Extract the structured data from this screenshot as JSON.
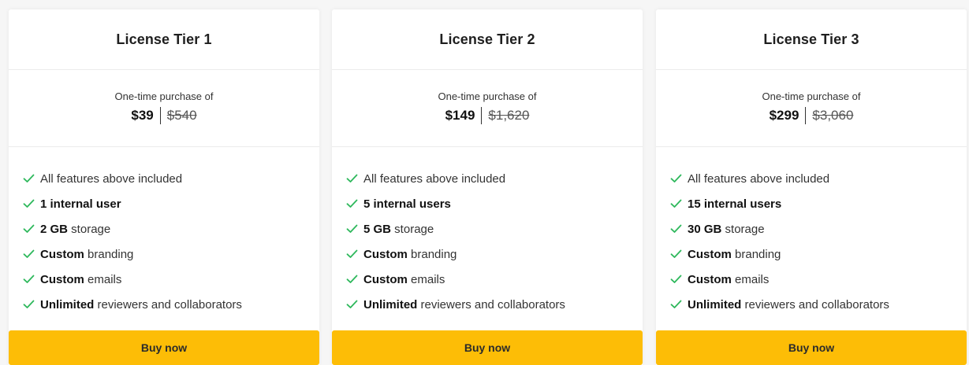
{
  "colors": {
    "accent_button": "#fdbd06",
    "check": "#2eb85c",
    "card_bg": "#ffffff",
    "page_bg": "#f6f6f6"
  },
  "tiers": [
    {
      "title": "License Tier 1",
      "price_caption": "One-time purchase of",
      "price": "$39",
      "old_price": "$540",
      "features": [
        {
          "icon": "check-icon",
          "bold": "",
          "text": "All features above included"
        },
        {
          "icon": "check-icon",
          "bold": "1 internal user",
          "text": ""
        },
        {
          "icon": "check-icon",
          "bold": "2 GB",
          "text": " storage"
        },
        {
          "icon": "check-icon",
          "bold": "Custom",
          "text": " branding"
        },
        {
          "icon": "check-icon",
          "bold": "Custom",
          "text": " emails"
        },
        {
          "icon": "check-icon",
          "bold": "Unlimited",
          "text": " reviewers and collaborators"
        }
      ],
      "button_label": "Buy now"
    },
    {
      "title": "License Tier 2",
      "price_caption": "One-time purchase of",
      "price": "$149",
      "old_price": "$1,620",
      "features": [
        {
          "icon": "check-icon",
          "bold": "",
          "text": "All features above included"
        },
        {
          "icon": "check-icon",
          "bold": "5 internal users",
          "text": ""
        },
        {
          "icon": "check-icon",
          "bold": "5 GB",
          "text": " storage"
        },
        {
          "icon": "check-icon",
          "bold": "Custom",
          "text": " branding"
        },
        {
          "icon": "check-icon",
          "bold": "Custom",
          "text": " emails"
        },
        {
          "icon": "check-icon",
          "bold": "Unlimited",
          "text": " reviewers and collaborators"
        }
      ],
      "button_label": "Buy now"
    },
    {
      "title": "License Tier 3",
      "price_caption": "One-time purchase of",
      "price": "$299",
      "old_price": "$3,060",
      "features": [
        {
          "icon": "check-icon",
          "bold": "",
          "text": "All features above included"
        },
        {
          "icon": "check-icon",
          "bold": "15 internal users",
          "text": ""
        },
        {
          "icon": "check-icon",
          "bold": "30 GB",
          "text": " storage"
        },
        {
          "icon": "check-icon",
          "bold": "Custom",
          "text": " branding"
        },
        {
          "icon": "check-icon",
          "bold": "Custom",
          "text": " emails"
        },
        {
          "icon": "check-icon",
          "bold": "Unlimited",
          "text": " reviewers and collaborators"
        }
      ],
      "button_label": "Buy now"
    }
  ]
}
